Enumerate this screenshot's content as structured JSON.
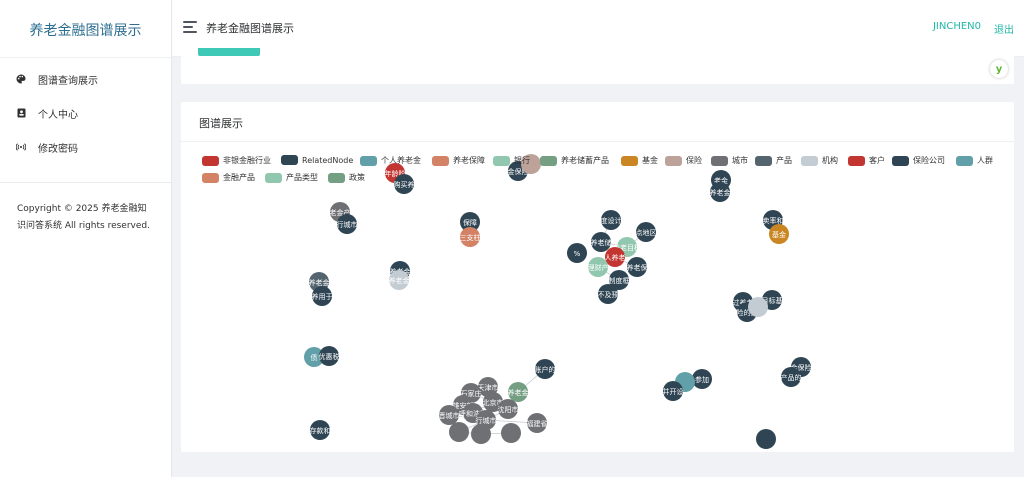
{
  "sidebar": {
    "brand": "养老金融图谱展示",
    "items": [
      {
        "label": "图谱查询展示",
        "icon": "palette-icon"
      },
      {
        "label": "个人中心",
        "icon": "id-card-icon"
      },
      {
        "label": "修改密码",
        "icon": "wireless-icon"
      }
    ],
    "copyright_line1": "Copyright © 2025 养老金融知",
    "copyright_line2": "识问答系统 All rights reserved."
  },
  "header": {
    "title": "养老金融图谱展示",
    "username": "JINCHEN0",
    "logout": "退出"
  },
  "card": {
    "title": "图谱展示"
  },
  "legend": [
    {
      "label": "非银金融行业",
      "color": "#c23531"
    },
    {
      "label": "RelatedNode",
      "color": "#2f4554"
    },
    {
      "label": "个人养老金",
      "color": "#61a0a8"
    },
    {
      "label": "养老保障",
      "color": "#d48265"
    },
    {
      "label": "银行",
      "color": "#91c7ae"
    },
    {
      "label": "养老储蓄产品",
      "color": "#749f83"
    },
    {
      "label": "基金",
      "color": "#ca8622"
    },
    {
      "label": "保险",
      "color": "#bda29a"
    },
    {
      "label": "城市",
      "color": "#6e7074"
    },
    {
      "label": "产品",
      "color": "#546570"
    },
    {
      "label": "机构",
      "color": "#c4ccd3"
    },
    {
      "label": "客户",
      "color": "#c23531"
    },
    {
      "label": "保险公司",
      "color": "#2f4554"
    },
    {
      "label": "人群",
      "color": "#61a0a8"
    },
    {
      "label": "金融产品",
      "color": "#d48265"
    },
    {
      "label": "产品类型",
      "color": "#91c7ae"
    },
    {
      "label": "政策",
      "color": "#749f83"
    }
  ],
  "graph": {
    "nodes": [
      {
        "label": "年龄阶",
        "color": "#c23531"
      },
      {
        "label": "购买养",
        "color": "#2f4554"
      },
      {
        "label": "金保险",
        "color": "#2f4554"
      },
      {
        "label": "",
        "color": "#bda29a"
      },
      {
        "label": "老金产",
        "color": "#6e7074"
      },
      {
        "label": "行城市",
        "color": "#2f4554"
      },
      {
        "label": "保障",
        "color": "#2f4554"
      },
      {
        "label": "三支柱",
        "color": "#d48265"
      },
      {
        "label": "度设计",
        "color": "#2f4554"
      },
      {
        "label": "点地区",
        "color": "#2f4554"
      },
      {
        "label": "养老储",
        "color": "#2f4554"
      },
      {
        "label": "养老目标",
        "color": "#91c7ae"
      },
      {
        "label": "%",
        "color": "#2f4554"
      },
      {
        "label": "人养老",
        "color": "#c23531"
      },
      {
        "label": "理财产",
        "color": "#91c7ae"
      },
      {
        "label": "养老保",
        "color": "#2f4554"
      },
      {
        "label": "制度框",
        "color": "#2f4554"
      },
      {
        "label": "不及预",
        "color": "#2f4554"
      },
      {
        "label": "老金",
        "color": "#2f4554"
      },
      {
        "label": "养老金",
        "color": "#2f4554"
      },
      {
        "label": "卖率和",
        "color": "#2f4554"
      },
      {
        "label": "基金",
        "color": "#ca8622"
      },
      {
        "label": "养老金",
        "color": "#2f4554"
      },
      {
        "label": "养老金",
        "color": "#c4ccd3"
      },
      {
        "label": "养老金",
        "color": "#546570"
      },
      {
        "label": "养用于",
        "color": "#2f4554"
      },
      {
        "label": "目标基",
        "color": "#2f4554"
      },
      {
        "label": "过养老",
        "color": "#2f4554"
      },
      {
        "label": "险的劳",
        "color": "#2f4554"
      },
      {
        "label": "",
        "color": "#c4ccd3"
      },
      {
        "label": "债",
        "color": "#61a0a8"
      },
      {
        "label": "优惠税",
        "color": "#2f4554"
      },
      {
        "label": "账户的",
        "color": "#2f4554"
      },
      {
        "label": "养老金",
        "color": "#749f83"
      },
      {
        "label": "天津市",
        "color": "#6e7074"
      },
      {
        "label": "石家庄",
        "color": "#6e7074"
      },
      {
        "label": "北京市",
        "color": "#6e7074"
      },
      {
        "label": "雄安新",
        "color": "#6e7074"
      },
      {
        "label": "呼和浩特",
        "color": "#6e7074"
      },
      {
        "label": "沈阳市",
        "color": "#6e7074"
      },
      {
        "label": "晋城市",
        "color": "#6e7074"
      },
      {
        "label": "行城市",
        "color": "#6e7074"
      },
      {
        "label": "福建省",
        "color": "#6e7074"
      },
      {
        "label": "",
        "color": "#6e7074"
      },
      {
        "label": "",
        "color": "#6e7074"
      },
      {
        "label": "",
        "color": "#6e7074"
      },
      {
        "label": "存款和",
        "color": "#2f4554"
      },
      {
        "label": "参加",
        "color": "#2f4554"
      },
      {
        "label": "",
        "color": "#61a0a8"
      },
      {
        "label": "并开设",
        "color": "#2f4554"
      },
      {
        "label": "金保险",
        "color": "#2f4554"
      },
      {
        "label": "产品的",
        "color": "#2f4554"
      },
      {
        "label": "",
        "color": "#2f4554"
      }
    ]
  }
}
